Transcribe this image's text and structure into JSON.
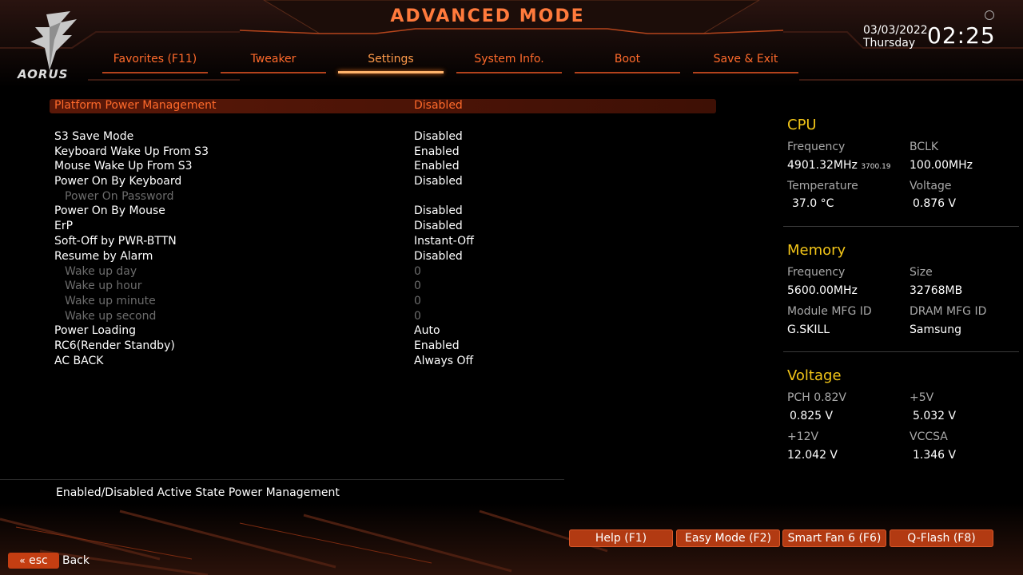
{
  "header": {
    "brand": "AORUS",
    "mode_title": "ADVANCED MODE",
    "date": "03/03/2022",
    "weekday": "Thursday",
    "time": "02:25"
  },
  "tabs": [
    {
      "label": "Favorites (F11)"
    },
    {
      "label": "Tweaker"
    },
    {
      "label": "Settings",
      "active": true
    },
    {
      "label": "System Info."
    },
    {
      "label": "Boot"
    },
    {
      "label": "Save & Exit"
    }
  ],
  "settings": [
    {
      "label": "Platform Power Management",
      "value": "Disabled",
      "selected": true
    },
    {
      "label": "S3 Save Mode",
      "value": "Disabled"
    },
    {
      "label": "Keyboard Wake Up From S3",
      "value": "Enabled"
    },
    {
      "label": "Mouse Wake Up From S3",
      "value": "Enabled"
    },
    {
      "label": "Power On By Keyboard",
      "value": "Disabled"
    },
    {
      "label": "Power On Password",
      "value": "",
      "sub": true
    },
    {
      "label": "Power On By Mouse",
      "value": "Disabled"
    },
    {
      "label": "ErP",
      "value": "Disabled"
    },
    {
      "label": "Soft-Off by PWR-BTTN",
      "value": "Instant-Off"
    },
    {
      "label": "Resume by Alarm",
      "value": "Disabled"
    },
    {
      "label": "Wake up day",
      "value": "0",
      "sub": true
    },
    {
      "label": "Wake up hour",
      "value": "0",
      "sub": true
    },
    {
      "label": "Wake up minute",
      "value": "0",
      "sub": true
    },
    {
      "label": "Wake up second",
      "value": "0",
      "sub": true
    },
    {
      "label": "Power Loading",
      "value": "Auto"
    },
    {
      "label": "RC6(Render Standby)",
      "value": "Enabled"
    },
    {
      "label": "AC BACK",
      "value": "Always Off"
    }
  ],
  "info": {
    "cpu": {
      "title": "CPU",
      "frequency_label": "Frequency",
      "frequency": "4901.32MHz",
      "frequency_small": "3700.19",
      "bclk_label": "BCLK",
      "bclk": "100.00MHz",
      "temperature_label": "Temperature",
      "temperature": "37.0 °C",
      "voltage_label": "Voltage",
      "voltage": "0.876 V"
    },
    "memory": {
      "title": "Memory",
      "frequency_label": "Frequency",
      "frequency": "5600.00MHz",
      "size_label": "Size",
      "size": "32768MB",
      "module_label": "Module MFG ID",
      "module": "G.SKILL",
      "dram_label": "DRAM MFG ID",
      "dram": "Samsung"
    },
    "voltage": {
      "title": "Voltage",
      "pch_label": "PCH 0.82V",
      "pch": "0.825 V",
      "p5_label": "+5V",
      "p5": "5.032 V",
      "p12_label": "+12V",
      "p12": "12.042 V",
      "vccsa_label": "VCCSA",
      "vccsa": "1.346 V"
    }
  },
  "help_text": "Enabled/Disabled Active State Power Management",
  "buttons": [
    {
      "label": "Help (F1)"
    },
    {
      "label": "Easy Mode (F2)"
    },
    {
      "label": "Smart Fan 6 (F6)"
    },
    {
      "label": "Q-Flash (F8)"
    }
  ],
  "esc": {
    "key": "esc",
    "label": "Back"
  },
  "colors": {
    "accent": "#ff6a2b",
    "panel_title": "#f2c518",
    "button": "#b23a12"
  }
}
